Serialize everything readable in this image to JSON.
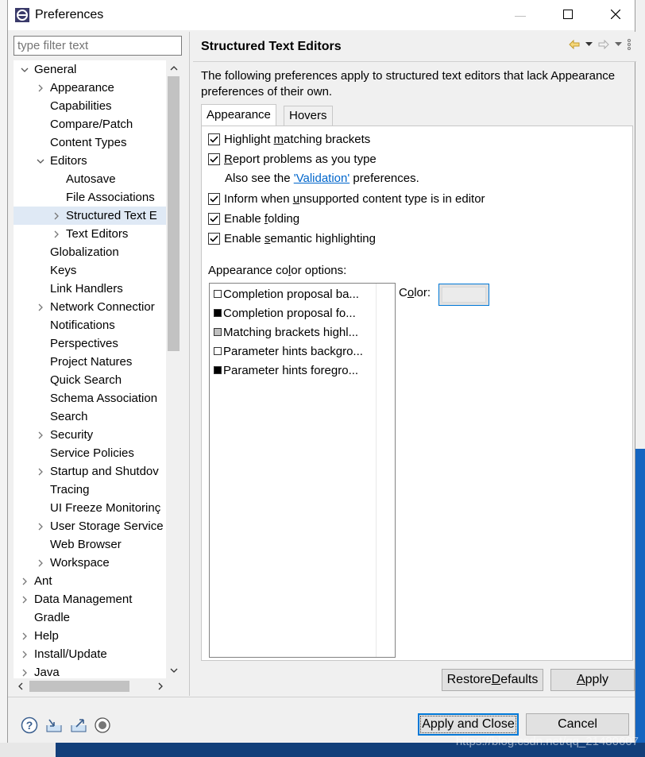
{
  "window": {
    "title": "Preferences",
    "minimize_glyph": "—",
    "maximize_glyph": "☐",
    "close_glyph": "✕"
  },
  "filter": {
    "placeholder": "type filter text"
  },
  "tree": [
    {
      "label": "General",
      "level": 0,
      "twisty": "expanded"
    },
    {
      "label": "Appearance",
      "level": 1,
      "twisty": "collapsed"
    },
    {
      "label": "Capabilities",
      "level": 1,
      "twisty": "none"
    },
    {
      "label": "Compare/Patch",
      "level": 1,
      "twisty": "none"
    },
    {
      "label": "Content Types",
      "level": 1,
      "twisty": "none"
    },
    {
      "label": "Editors",
      "level": 1,
      "twisty": "expanded"
    },
    {
      "label": "Autosave",
      "level": 2,
      "twisty": "none"
    },
    {
      "label": "File Associations",
      "level": 2,
      "twisty": "none"
    },
    {
      "label": "Structured Text E",
      "level": 2,
      "twisty": "collapsed",
      "selected": true
    },
    {
      "label": "Text Editors",
      "level": 2,
      "twisty": "collapsed"
    },
    {
      "label": "Globalization",
      "level": 1,
      "twisty": "none"
    },
    {
      "label": "Keys",
      "level": 1,
      "twisty": "none"
    },
    {
      "label": "Link Handlers",
      "level": 1,
      "twisty": "none"
    },
    {
      "label": "Network Connectior",
      "level": 1,
      "twisty": "collapsed"
    },
    {
      "label": "Notifications",
      "level": 1,
      "twisty": "none"
    },
    {
      "label": "Perspectives",
      "level": 1,
      "twisty": "none"
    },
    {
      "label": "Project Natures",
      "level": 1,
      "twisty": "none"
    },
    {
      "label": "Quick Search",
      "level": 1,
      "twisty": "none"
    },
    {
      "label": "Schema Association",
      "level": 1,
      "twisty": "none"
    },
    {
      "label": "Search",
      "level": 1,
      "twisty": "none"
    },
    {
      "label": "Security",
      "level": 1,
      "twisty": "collapsed"
    },
    {
      "label": "Service Policies",
      "level": 1,
      "twisty": "none"
    },
    {
      "label": "Startup and Shutdov",
      "level": 1,
      "twisty": "collapsed"
    },
    {
      "label": "Tracing",
      "level": 1,
      "twisty": "none"
    },
    {
      "label": "UI Freeze Monitorinç",
      "level": 1,
      "twisty": "none"
    },
    {
      "label": "User Storage Service",
      "level": 1,
      "twisty": "collapsed"
    },
    {
      "label": "Web Browser",
      "level": 1,
      "twisty": "none"
    },
    {
      "label": "Workspace",
      "level": 1,
      "twisty": "collapsed"
    },
    {
      "label": "Ant",
      "level": 0,
      "twisty": "collapsed"
    },
    {
      "label": "Data Management",
      "level": 0,
      "twisty": "collapsed"
    },
    {
      "label": "Gradle",
      "level": 0,
      "twisty": "none"
    },
    {
      "label": "Help",
      "level": 0,
      "twisty": "collapsed"
    },
    {
      "label": "Install/Update",
      "level": 0,
      "twisty": "collapsed"
    },
    {
      "label": "Java",
      "level": 0,
      "twisty": "collapsed"
    }
  ],
  "page": {
    "title": "Structured Text Editors",
    "description": "The following preferences apply to structured text editors that lack Appearance preferences of their own."
  },
  "tabs": [
    {
      "label": "Appearance",
      "active": true
    },
    {
      "label": "Hovers",
      "active": false
    }
  ],
  "options": {
    "highlight_brackets": {
      "before": "Highlight ",
      "mnemonic": "m",
      "after": "atching brackets",
      "checked": true
    },
    "report_problems": {
      "before": "",
      "mnemonic": "R",
      "after": "eport problems as you type",
      "checked": true
    },
    "see_also": {
      "before": "Also see the ",
      "link": "'Validation'",
      "after": " preferences."
    },
    "inform_unsupported": {
      "before": "Inform when ",
      "mnemonic": "u",
      "after": "nsupported content type is in editor",
      "checked": true
    },
    "enable_folding": {
      "before": "Enable ",
      "mnemonic": "f",
      "after": "olding",
      "checked": true
    },
    "semantic_highlighting": {
      "before": "Enable ",
      "mnemonic": "s",
      "after": "emantic highlighting",
      "checked": true
    }
  },
  "color_options": {
    "heading_before": "Appearance co",
    "heading_mnemonic": "l",
    "heading_after": "or options:",
    "items": [
      {
        "label": "Completion proposal ba...",
        "swatch": "#ffffff"
      },
      {
        "label": "Completion proposal fo...",
        "swatch": "#000000"
      },
      {
        "label": "Matching brackets highl...",
        "swatch": "#c0c0c0"
      },
      {
        "label": "Parameter hints backgro...",
        "swatch": "#ffffff"
      },
      {
        "label": "Parameter hints foregro...",
        "swatch": "#000000"
      }
    ],
    "color_label_before": "C",
    "color_label_mnemonic": "o",
    "color_label_after": "lor:"
  },
  "buttons": {
    "restore_before": "Restore ",
    "restore_mnemonic": "D",
    "restore_after": "efaults",
    "apply_before": "",
    "apply_mnemonic": "A",
    "apply_after": "pply",
    "apply_and_close": "Apply and Close",
    "cancel": "Cancel"
  },
  "watermark": "https://blog.csdn.net/qq_21480607",
  "colors": {
    "selection": "#dfe9f5",
    "link": "#0066cc",
    "default_button_border": "#0078d7"
  }
}
